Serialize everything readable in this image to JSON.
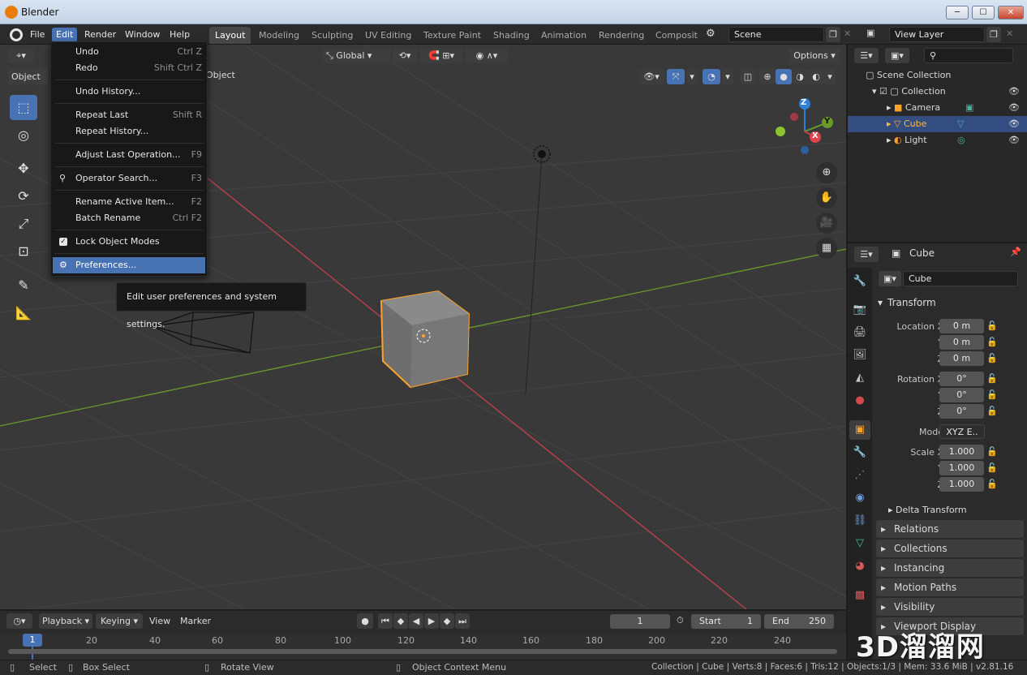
{
  "window": {
    "title": "Blender",
    "minimize": "─",
    "maximize": "☐",
    "close": "✕"
  },
  "menubar": {
    "items": [
      "File",
      "Edit",
      "Render",
      "Window",
      "Help"
    ],
    "active": "Edit"
  },
  "workspaces": [
    "Layout",
    "Modeling",
    "Sculpting",
    "UV Editing",
    "Texture Paint",
    "Shading",
    "Animation",
    "Rendering",
    "Compositi"
  ],
  "scene": {
    "name": "Scene",
    "view_layer": "View Layer"
  },
  "viewport": {
    "transform_orientation": "Global",
    "options_label": "Options",
    "mode_label": "Object",
    "object_menu": "Object"
  },
  "edit_menu": {
    "items": [
      {
        "label": "Undo",
        "shortcut": "Ctrl Z"
      },
      {
        "label": "Redo",
        "shortcut": "Shift Ctrl Z"
      },
      {
        "label": "Undo History...",
        "shortcut": ""
      },
      {
        "label": "Repeat Last",
        "shortcut": "Shift R"
      },
      {
        "label": "Repeat History...",
        "shortcut": ""
      },
      {
        "label": "Adjust Last Operation...",
        "shortcut": "F9"
      },
      {
        "label": "Operator Search...",
        "shortcut": "F3"
      },
      {
        "label": "Rename Active Item...",
        "shortcut": "F2"
      },
      {
        "label": "Batch Rename",
        "shortcut": "Ctrl F2"
      },
      {
        "label": "Lock Object Modes",
        "shortcut": ""
      },
      {
        "label": "Preferences...",
        "shortcut": ""
      }
    ],
    "tooltip": "Edit user preferences and system settings."
  },
  "outliner": {
    "root": "Scene Collection",
    "collection": "Collection",
    "items": [
      "Camera",
      "Cube",
      "Light"
    ],
    "selected": "Cube"
  },
  "properties": {
    "object_name": "Cube",
    "data_name": "Cube",
    "transform_header": "Transform",
    "location": {
      "label_x": "Location X",
      "x": "0 m",
      "y": "0 m",
      "z": "0 m"
    },
    "rotation": {
      "label_x": "Rotation X",
      "x": "0°",
      "y": "0°",
      "z": "0°"
    },
    "mode": {
      "label": "Mode",
      "value": "XYZ E.."
    },
    "scale": {
      "label_x": "Scale X",
      "x": "1.000",
      "y": "1.000",
      "z": "1.000"
    },
    "axis_labels": {
      "y": "Y",
      "z": "Z"
    },
    "delta": "Delta Transform",
    "panels": [
      "Relations",
      "Collections",
      "Instancing",
      "Motion Paths",
      "Visibility",
      "Viewport Display"
    ]
  },
  "timeline": {
    "menus": [
      "Playback",
      "Keying",
      "View",
      "Marker"
    ],
    "current_frame": "1",
    "start_label": "Start",
    "start": "1",
    "end_label": "End",
    "end": "250",
    "ticks": [
      "1",
      "20",
      "40",
      "60",
      "80",
      "100",
      "120",
      "140",
      "160",
      "180",
      "200",
      "220",
      "240"
    ]
  },
  "statusbar": {
    "select": "Select",
    "box_select": "Box Select",
    "rotate_view": "Rotate View",
    "context_menu": "Object Context Menu",
    "stats": "Collection | Cube | Verts:8 | Faces:6 | Tris:12 | Objects:1/3 | Mem: 33.6 MiB | v2.81.16"
  },
  "watermark": "3D溜溜网",
  "gizmo": {
    "x": "X",
    "y": "Y",
    "z": "Z"
  },
  "colors": {
    "accent": "#4772b3",
    "selection": "#ffa12b",
    "x_axis": "#c2404e",
    "y_axis": "#6a9a2a",
    "z_axis": "#2f7fd6"
  }
}
